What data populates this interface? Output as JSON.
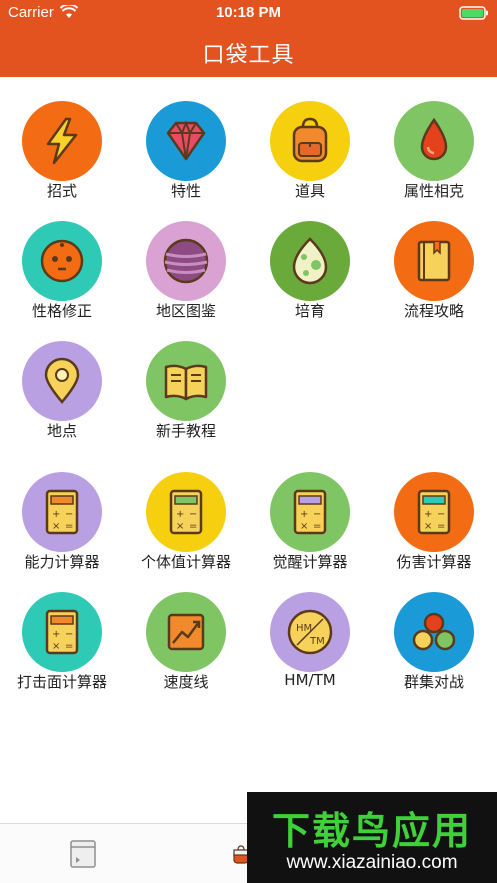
{
  "status_bar": {
    "carrier": "Carrier",
    "time": "10:18 PM"
  },
  "nav": {
    "title": "口袋工具"
  },
  "tools": [
    {
      "label": "招式",
      "color": "#f36b12",
      "icon": "lightning-icon"
    },
    {
      "label": "特性",
      "color": "#1a9ad6",
      "icon": "gem-icon"
    },
    {
      "label": "道具",
      "color": "#f6cf0f",
      "icon": "backpack-icon"
    },
    {
      "label": "属性相克",
      "color": "#7fc564",
      "icon": "drop-icon"
    },
    {
      "label": "性格修正",
      "color": "#2fcab5",
      "icon": "face-icon"
    },
    {
      "label": "地区图鉴",
      "color": "#d9a2d2",
      "icon": "sphere-icon"
    },
    {
      "label": "培育",
      "color": "#6aaa3b",
      "icon": "egg-icon"
    },
    {
      "label": "流程攻略",
      "color": "#f36b12",
      "icon": "book-icon"
    },
    {
      "label": "地点",
      "color": "#b8a0e2",
      "icon": "map-pin-icon"
    },
    {
      "label": "新手教程",
      "color": "#7fc564",
      "icon": "open-book-icon"
    },
    {
      "label": "能力计算器",
      "color": "#b8a0e2",
      "icon": "calculator-icon"
    },
    {
      "label": "个体值计算器",
      "color": "#f6cf0f",
      "icon": "calculator-icon"
    },
    {
      "label": "觉醒计算器",
      "color": "#7fc564",
      "icon": "calculator-icon"
    },
    {
      "label": "伤害计算器",
      "color": "#f36b12",
      "icon": "calculator-icon"
    },
    {
      "label": "打击面计算器",
      "color": "#2fcab5",
      "icon": "calculator-icon"
    },
    {
      "label": "速度线",
      "color": "#7fc564",
      "icon": "chart-up-icon"
    },
    {
      "label": "HM/TM",
      "color": "#b8a0e2",
      "icon": "disc-icon"
    },
    {
      "label": "群集对战",
      "color": "#1a9ad6",
      "icon": "balls-icon"
    }
  ],
  "disc_text": {
    "top": "HM",
    "bottom": "TM"
  },
  "watermark": {
    "title": "下载鸟应用",
    "url": "www.xiazainiao.com"
  }
}
